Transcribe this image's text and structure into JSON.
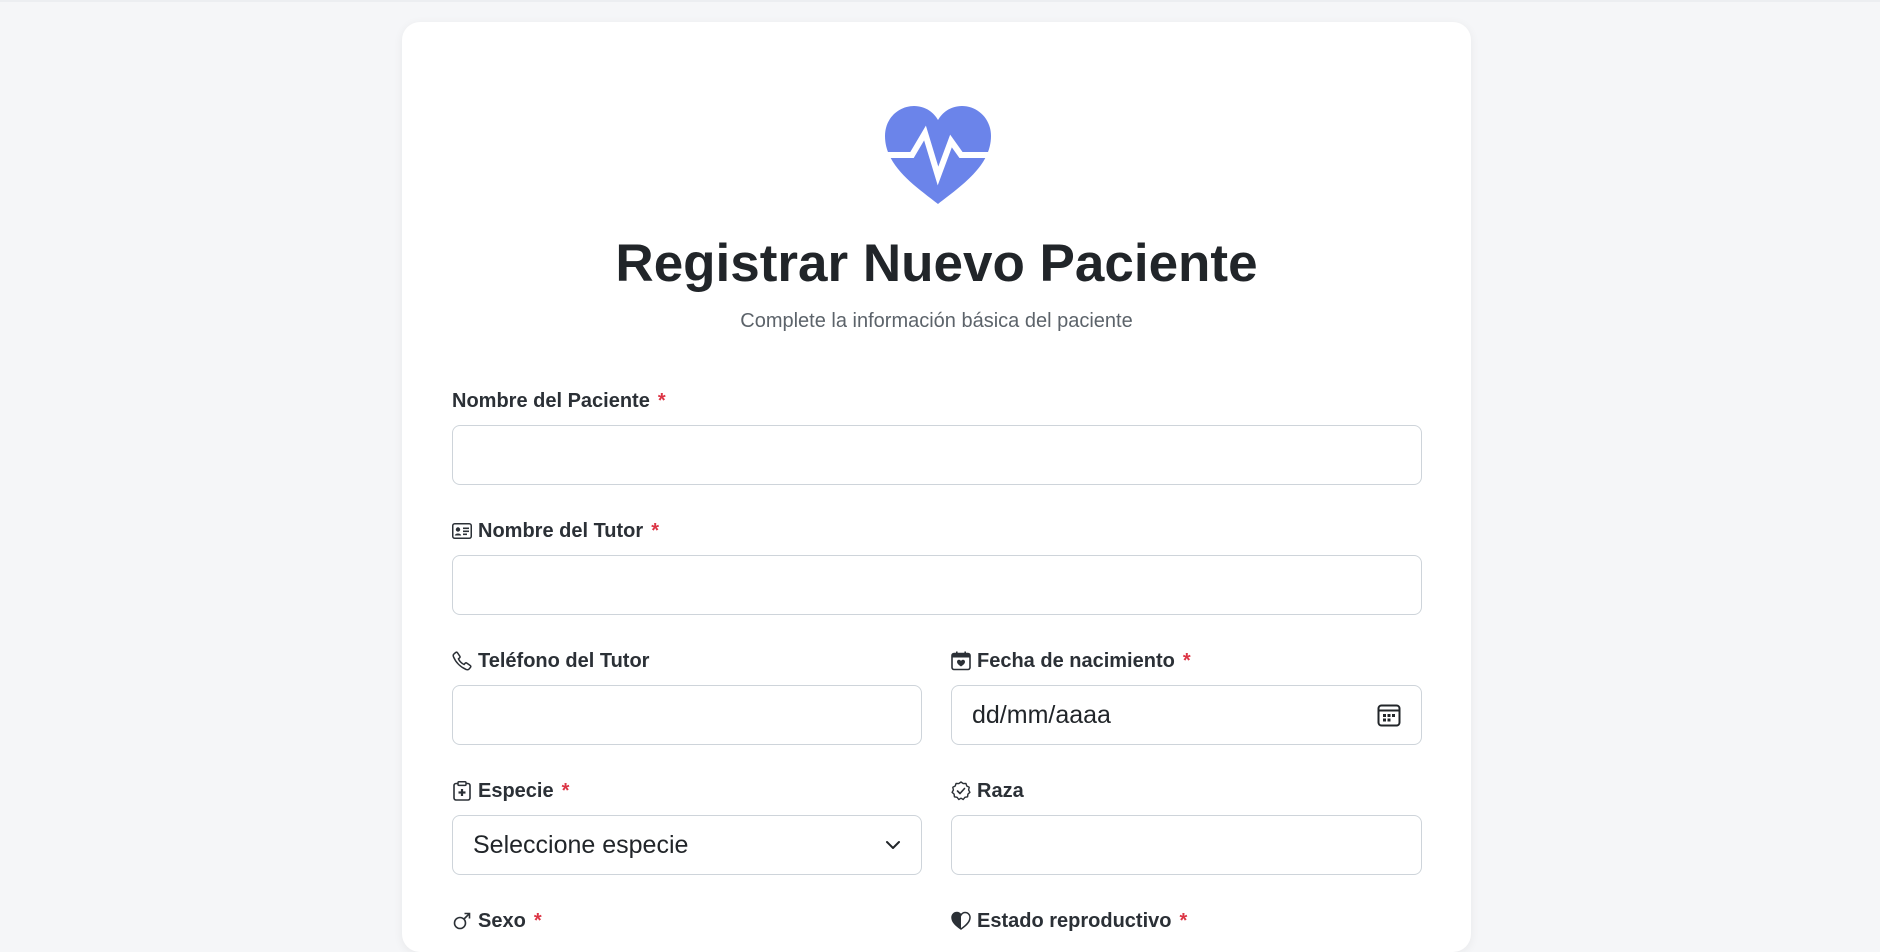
{
  "header": {
    "title": "Registrar Nuevo Paciente",
    "subtitle": "Complete la información básica del paciente"
  },
  "colors": {
    "accent": "#6b84ea",
    "required": "#dc3545",
    "background": "#f5f6f8"
  },
  "form": {
    "patient_name": {
      "label": "Nombre del Paciente",
      "required_mark": "*",
      "value": ""
    },
    "tutor_name": {
      "label": "Nombre del Tutor",
      "required_mark": "*",
      "value": "",
      "icon": "id-card-icon"
    },
    "tutor_phone": {
      "label": "Teléfono del Tutor",
      "value": "",
      "icon": "phone-icon"
    },
    "birth_date": {
      "label": "Fecha de nacimiento",
      "required_mark": "*",
      "value": "dd/mm/aaaa",
      "icon": "calendar-heart-icon"
    },
    "species": {
      "label": "Especie",
      "required_mark": "*",
      "selected": "Seleccione especie",
      "icon": "clipboard-pulse-icon"
    },
    "breed": {
      "label": "Raza",
      "value": "",
      "icon": "patch-check-icon"
    },
    "sex": {
      "label": "Sexo",
      "required_mark": "*",
      "icon": "gender-male-icon"
    },
    "reproductive_status": {
      "label": "Estado reproductivo",
      "required_mark": "*",
      "icon": "heart-half-icon"
    }
  }
}
